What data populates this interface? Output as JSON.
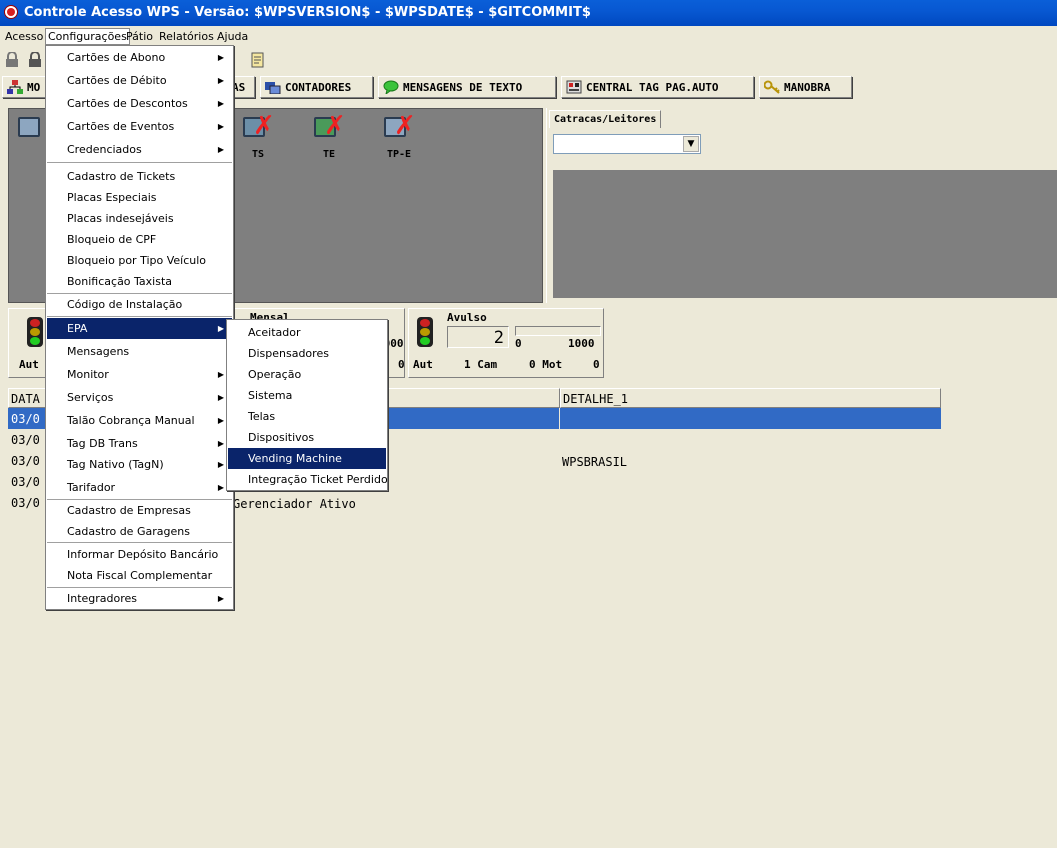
{
  "window": {
    "title": "Controle Acesso WPS - Versão: $WPSVERSION$ - $WPSDATE$ - $GITCOMMIT$"
  },
  "menubar": [
    "Acesso",
    "Configurações",
    "Pátio",
    "Relatórios",
    "Ajuda"
  ],
  "tabs": [
    "MO",
    "AS",
    "CONTADORES",
    "MENSAGENS DE TEXTO",
    "CENTRAL TAG PAG.AUTO",
    "MANOBRA"
  ],
  "devices": [
    "L",
    "TS",
    "TE",
    "TP-E"
  ],
  "catracas": {
    "tab": "Catracas/Leitores",
    "selected": ""
  },
  "status": {
    "left_label": "Aut",
    "mensal": {
      "title": "Mensal",
      "limit": "1000",
      "count": "0"
    },
    "avulso": {
      "title": "Avulso",
      "current": "2",
      "min": "0",
      "max": "1000",
      "aut_label": "Aut",
      "cam": "1 Cam",
      "mot": "0 Mot",
      "last": "0"
    }
  },
  "grid": {
    "headers": [
      "DATA",
      "DETALHE_1"
    ],
    "rows": [
      {
        "date": "03/0",
        "msg": "",
        "detail": ""
      },
      {
        "date": "03/0",
        "msg": "",
        "detail": ""
      },
      {
        "date": "03/0",
        "msg": "",
        "detail": "WPSBRASIL"
      },
      {
        "date": "03/0",
        "msg": "",
        "detail": ""
      },
      {
        "date": "03/0",
        "msg": "Gerenciador Ativo",
        "detail": ""
      }
    ]
  },
  "config_menu": [
    "Cartões de Abono",
    "Cartões de Débito",
    "Cartões de Descontos",
    "Cartões de Eventos",
    "Credenciados",
    "Cadastro de Tickets",
    "Placas Especiais",
    "Placas indesejáveis",
    "Bloqueio de CPF",
    "Bloqueio por Tipo Veículo",
    "Bonificação Taxista",
    "Código de Instalação",
    "EPA",
    "Mensagens",
    "Monitor",
    "Serviços",
    "Talão Cobrança Manual",
    "Tag DB Trans",
    "Tag Nativo (TagN)",
    "Tarifador",
    "Cadastro de Empresas",
    "Cadastro de Garagens",
    "Informar Depósito Bancário",
    "Nota Fiscal Complementar",
    "Integradores"
  ],
  "epa_menu": [
    "Aceitador",
    "Dispensadores",
    "Operação",
    "Sistema",
    "Telas",
    "Dispositivos",
    "Vending Machine",
    "Integração Ticket Perdido"
  ],
  "colors": {
    "menu_highlight": "#0A246A",
    "grid_selected": "#316AC5",
    "title_bar": "#0A5FD8"
  }
}
